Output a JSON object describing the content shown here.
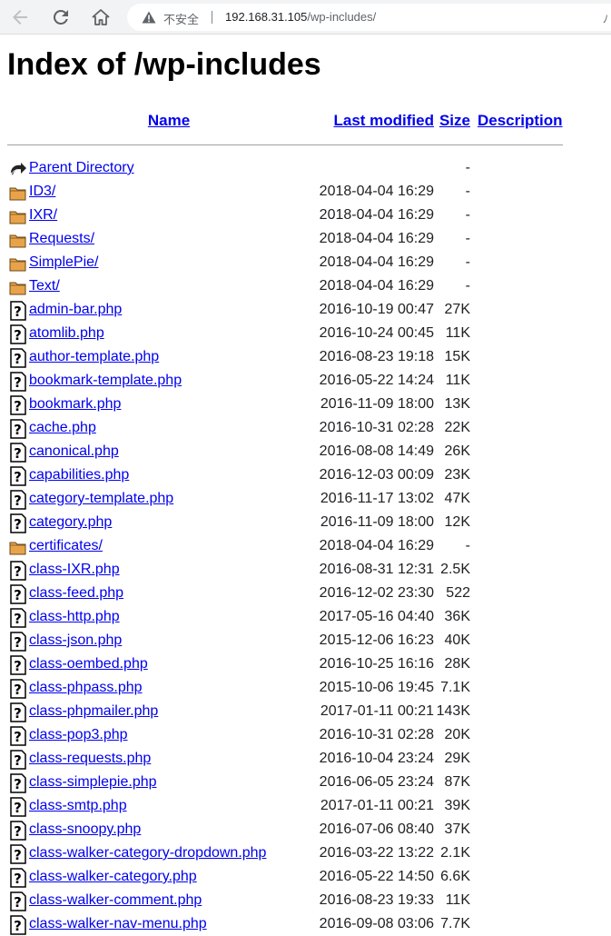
{
  "browser": {
    "insecure_label": "不安全",
    "url_host": "192.168.31.105",
    "url_path": "/wp-includes/"
  },
  "page": {
    "title": "Index of /wp-includes"
  },
  "table": {
    "headers": {
      "name": "Name",
      "last_modified": "Last modified",
      "size": "Size",
      "description": "Description"
    },
    "rows": [
      {
        "name": "Parent Directory",
        "date": "",
        "size": "-",
        "icon": "back-icon"
      },
      {
        "name": "ID3/",
        "date": "2018-04-04 16:29",
        "size": "-",
        "icon": "folder-icon"
      },
      {
        "name": "IXR/",
        "date": "2018-04-04 16:29",
        "size": "-",
        "icon": "folder-icon"
      },
      {
        "name": "Requests/",
        "date": "2018-04-04 16:29",
        "size": "-",
        "icon": "folder-icon"
      },
      {
        "name": "SimplePie/",
        "date": "2018-04-04 16:29",
        "size": "-",
        "icon": "folder-icon"
      },
      {
        "name": "Text/",
        "date": "2018-04-04 16:29",
        "size": "-",
        "icon": "folder-icon"
      },
      {
        "name": "admin-bar.php",
        "date": "2016-10-19 00:47",
        "size": "27K",
        "icon": "unknown-file-icon"
      },
      {
        "name": "atomlib.php",
        "date": "2016-10-24 00:45",
        "size": "11K",
        "icon": "unknown-file-icon"
      },
      {
        "name": "author-template.php",
        "date": "2016-08-23 19:18",
        "size": "15K",
        "icon": "unknown-file-icon"
      },
      {
        "name": "bookmark-template.php",
        "date": "2016-05-22 14:24",
        "size": "11K",
        "icon": "unknown-file-icon"
      },
      {
        "name": "bookmark.php",
        "date": "2016-11-09 18:00",
        "size": "13K",
        "icon": "unknown-file-icon"
      },
      {
        "name": "cache.php",
        "date": "2016-10-31 02:28",
        "size": "22K",
        "icon": "unknown-file-icon"
      },
      {
        "name": "canonical.php",
        "date": "2016-08-08 14:49",
        "size": "26K",
        "icon": "unknown-file-icon"
      },
      {
        "name": "capabilities.php",
        "date": "2016-12-03 00:09",
        "size": "23K",
        "icon": "unknown-file-icon"
      },
      {
        "name": "category-template.php",
        "date": "2016-11-17 13:02",
        "size": "47K",
        "icon": "unknown-file-icon"
      },
      {
        "name": "category.php",
        "date": "2016-11-09 18:00",
        "size": "12K",
        "icon": "unknown-file-icon"
      },
      {
        "name": "certificates/",
        "date": "2018-04-04 16:29",
        "size": "-",
        "icon": "folder-icon"
      },
      {
        "name": "class-IXR.php",
        "date": "2016-08-31 12:31",
        "size": "2.5K",
        "icon": "unknown-file-icon"
      },
      {
        "name": "class-feed.php",
        "date": "2016-12-02 23:30",
        "size": "522",
        "icon": "unknown-file-icon"
      },
      {
        "name": "class-http.php",
        "date": "2017-05-16 04:40",
        "size": "36K",
        "icon": "unknown-file-icon"
      },
      {
        "name": "class-json.php",
        "date": "2015-12-06 16:23",
        "size": "40K",
        "icon": "unknown-file-icon"
      },
      {
        "name": "class-oembed.php",
        "date": "2016-10-25 16:16",
        "size": "28K",
        "icon": "unknown-file-icon"
      },
      {
        "name": "class-phpass.php",
        "date": "2015-10-06 19:45",
        "size": "7.1K",
        "icon": "unknown-file-icon"
      },
      {
        "name": "class-phpmailer.php",
        "date": "2017-01-11 00:21",
        "size": "143K",
        "icon": "unknown-file-icon"
      },
      {
        "name": "class-pop3.php",
        "date": "2016-10-31 02:28",
        "size": "20K",
        "icon": "unknown-file-icon"
      },
      {
        "name": "class-requests.php",
        "date": "2016-10-04 23:24",
        "size": "29K",
        "icon": "unknown-file-icon"
      },
      {
        "name": "class-simplepie.php",
        "date": "2016-06-05 23:24",
        "size": "87K",
        "icon": "unknown-file-icon"
      },
      {
        "name": "class-smtp.php",
        "date": "2017-01-11 00:21",
        "size": "39K",
        "icon": "unknown-file-icon"
      },
      {
        "name": "class-snoopy.php",
        "date": "2016-07-06 08:40",
        "size": "37K",
        "icon": "unknown-file-icon"
      },
      {
        "name": "class-walker-category-dropdown.php",
        "date": "2016-03-22 13:22",
        "size": "2.1K",
        "icon": "unknown-file-icon"
      },
      {
        "name": "class-walker-category.php",
        "date": "2016-05-22 14:50",
        "size": "6.6K",
        "icon": "unknown-file-icon"
      },
      {
        "name": "class-walker-comment.php",
        "date": "2016-08-23 19:33",
        "size": "11K",
        "icon": "unknown-file-icon"
      },
      {
        "name": "class-walker-nav-menu.php",
        "date": "2016-09-08 03:06",
        "size": "7.7K",
        "icon": "unknown-file-icon"
      }
    ]
  }
}
